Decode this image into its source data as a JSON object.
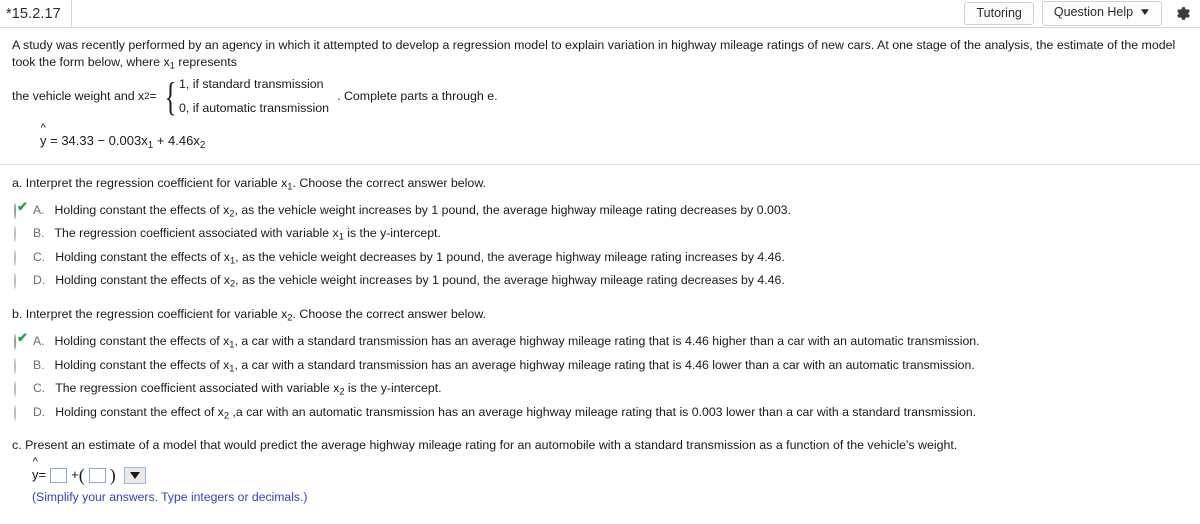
{
  "header": {
    "tab_label": "*15.2.17",
    "tutoring_label": "Tutoring",
    "question_help_label": "Question Help",
    "caret_glyph": "▼",
    "gear_icon": "gear-icon"
  },
  "problem": {
    "intro_part1": "A study was recently performed by an agency in which it attempted to develop a regression model to explain variation in highway mileage ratings of new cars. At one stage of the analysis, the estimate of the model took the form below, where x",
    "intro_sub1": "1",
    "intro_part2": " represents",
    "line2_prefix": "the vehicle weight and x",
    "line2_sub": "2",
    "line2_eq": " = ",
    "case_1": "1, if standard transmission",
    "case_2": "0, if automatic transmission",
    "after_brace": ". Complete parts a through e.",
    "equation": {
      "yhat": "y",
      "hat": "^",
      "body_1": " = 34.33 − 0.003x",
      "sub_1": "1",
      "body_2": " + 4.46x",
      "sub_2": "2"
    }
  },
  "part_a": {
    "prompt_1": "a. Interpret the regression coefficient for variable x",
    "prompt_sub": "1",
    "prompt_2": ". Choose the correct answer below.",
    "options": [
      {
        "letter": "A.",
        "selected": true,
        "text_1": "Holding constant the effects of x",
        "sub": "2",
        "text_2": ", as the vehicle weight increases by 1 pound, the average highway mileage rating decreases by 0.003."
      },
      {
        "letter": "B.",
        "selected": false,
        "text_1": "The regression coefficient associated with variable x",
        "sub": "1",
        "text_2": " is the y-intercept."
      },
      {
        "letter": "C.",
        "selected": false,
        "text_1": "Holding constant the effects of x",
        "sub": "1",
        "text_2": ", as the vehicle weight decreases by 1 pound, the average highway mileage rating increases by 4.46."
      },
      {
        "letter": "D.",
        "selected": false,
        "text_1": "Holding constant the effects of x",
        "sub": "2",
        "text_2": ", as the vehicle weight increases by 1 pound, the average highway mileage rating decreases by 4.46."
      }
    ]
  },
  "part_b": {
    "prompt_1": "b. Interpret the regression coefficient for variable x",
    "prompt_sub": "2",
    "prompt_2": ". Choose the correct answer below.",
    "options": [
      {
        "letter": "A.",
        "selected": true,
        "text_1": "Holding constant the effects of x",
        "sub": "1",
        "text_2": ", a car with a standard transmission has an average highway mileage rating that is 4.46 higher than a car with an automatic transmission."
      },
      {
        "letter": "B.",
        "selected": false,
        "text_1": "Holding constant the effects of x",
        "sub": "1",
        "text_2": ", a car with a standard transmission has an average highway mileage rating that is 4.46 lower than a car with an automatic transmission."
      },
      {
        "letter": "C.",
        "selected": false,
        "text_1": "The regression coefficient associated with variable x",
        "sub": "2",
        "text_2": " is the y-intercept."
      },
      {
        "letter": "D.",
        "selected": false,
        "text_1": "Holding constant the effect of x",
        "sub": "2",
        "text_2": " ,a car with an automatic transmission has an average highway mileage rating that is 0.003 lower than a car with a standard transmission."
      }
    ]
  },
  "part_c": {
    "prompt": "c. Present an estimate of a model that would predict the average highway mileage rating for an automobile with a standard transmission as a function of the vehicle's weight.",
    "answer": {
      "yhat": "y",
      "hat": "^",
      "equals": " = ",
      "box1_value": "",
      "plus": "+",
      "open_paren": "(",
      "box2_value": "",
      "close_paren": ")",
      "dropdown_value": ""
    },
    "hint": "(Simplify your answers. Type integers or decimals.)"
  }
}
